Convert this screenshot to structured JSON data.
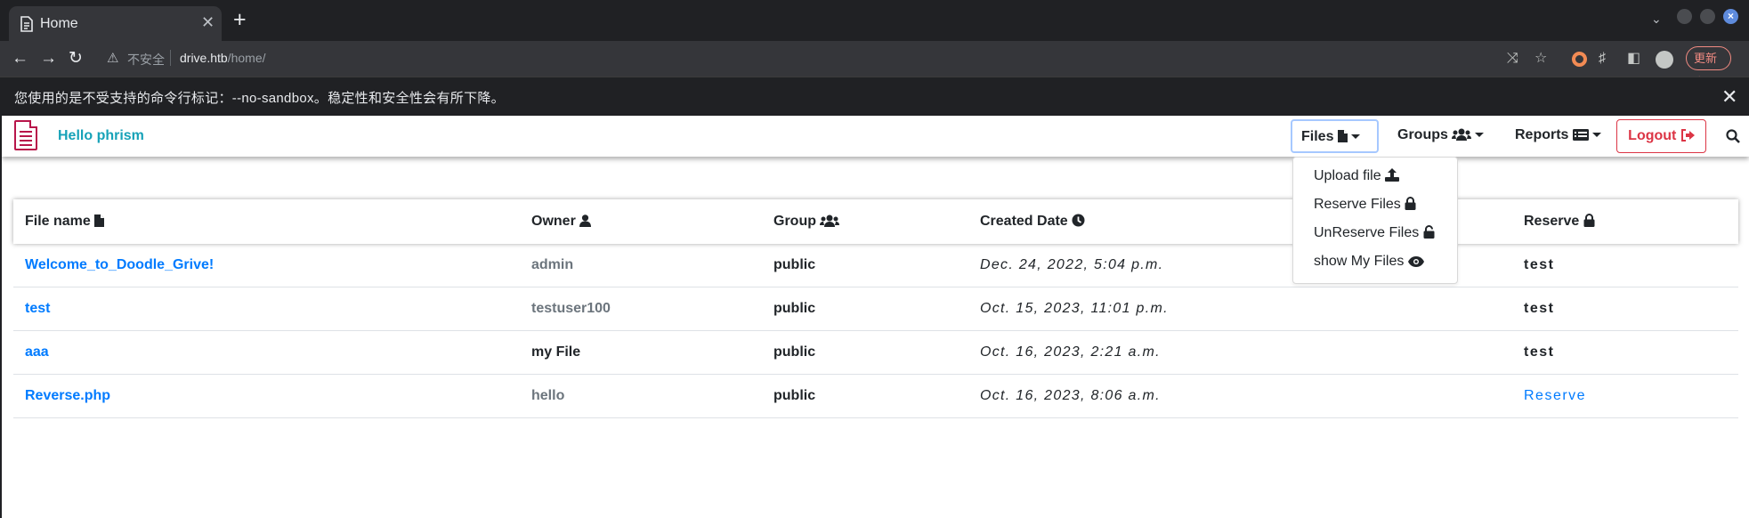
{
  "browser": {
    "tab_title": "Home",
    "tab_close": "✕",
    "new_tab": "+",
    "insecure_label": "不安全",
    "url_host": "drive.htb",
    "url_path": "/home/",
    "update_label": "更新",
    "infobar_message": "您使用的是不受支持的命令行标记：--no-sandbox。稳定性和安全性会有所下降。",
    "infobar_close": "✕"
  },
  "navbar": {
    "brand": "Hello phrism",
    "files_label": "Files",
    "groups_label": "Groups",
    "reports_label": "Reports",
    "logout_label": "Logout"
  },
  "files_menu": {
    "items": [
      {
        "label": "Upload file",
        "icon": "upload-icon"
      },
      {
        "label": "Reserve Files",
        "icon": "lock-icon"
      },
      {
        "label": "UnReserve Files",
        "icon": "unlock-icon"
      },
      {
        "label": "show My Files",
        "icon": "eye-icon"
      }
    ]
  },
  "table": {
    "headers": {
      "file_name": "File name",
      "owner": "Owner",
      "group": "Group",
      "created_date": "Created Date",
      "reserve": "Reserve"
    },
    "rows": [
      {
        "file_name": "Welcome_to_Doodle_Grive!",
        "owner": "admin",
        "group": "public",
        "created": "Dec. 24, 2022, 5:04 p.m.",
        "reserve": "test"
      },
      {
        "file_name": "test",
        "owner": "testuser100",
        "group": "public",
        "created": "Oct. 15, 2023, 11:01 p.m.",
        "reserve": "test"
      },
      {
        "file_name": "aaa",
        "owner": "my File",
        "group": "public",
        "created": "Oct. 16, 2023, 2:21 a.m.",
        "reserve": "test"
      },
      {
        "file_name": "Reverse.php",
        "owner": "hello",
        "group": "public",
        "created": "Oct. 16, 2023, 8:06 a.m.",
        "reserve": "Reserve"
      }
    ]
  },
  "colors": {
    "brand": "#17a2b8",
    "link": "#007bff",
    "logout": "#dc3545",
    "logo": "#b8154a"
  }
}
